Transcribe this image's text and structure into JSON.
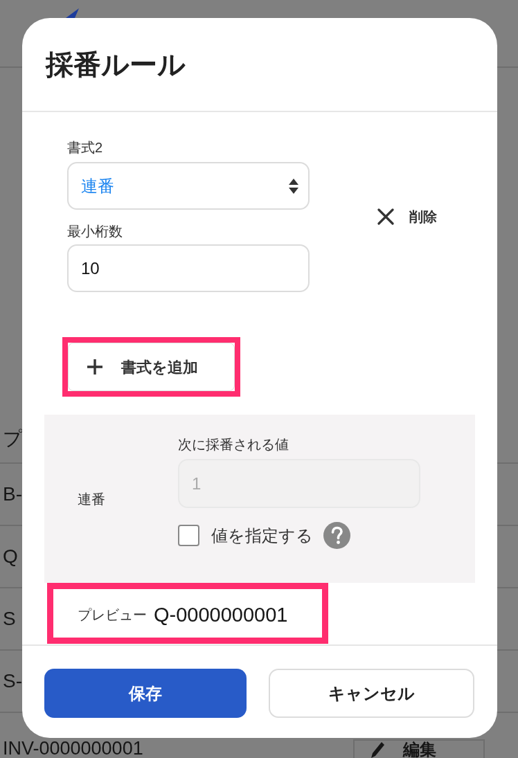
{
  "background": {
    "header_cell": "プ",
    "rows": [
      {
        "text": "B-"
      },
      {
        "text": "Q"
      },
      {
        "text": "S"
      },
      {
        "text": "S-"
      },
      {
        "text": "INV-0000000001",
        "button": "編集"
      }
    ]
  },
  "dialog": {
    "title": "採番ルール",
    "format": {
      "label": "書式2",
      "value": "連番"
    },
    "min_digits": {
      "label": "最小桁数",
      "value": "10"
    },
    "delete_button": "削除",
    "add_button": {
      "label": "書式を追加",
      "highlighted": true
    },
    "sequence_panel": {
      "label": "連番",
      "next_value": {
        "label": "次に採番される値",
        "value": "1",
        "disabled": true
      },
      "specify": {
        "label": "値を指定する",
        "checked": false
      }
    },
    "preview": {
      "label": "プレビュー",
      "value": "Q-0000000001",
      "highlighted": true
    },
    "buttons": [
      {
        "label": "保存",
        "kind": "primary"
      },
      {
        "label": "キャンセル",
        "kind": "secondary"
      }
    ]
  }
}
